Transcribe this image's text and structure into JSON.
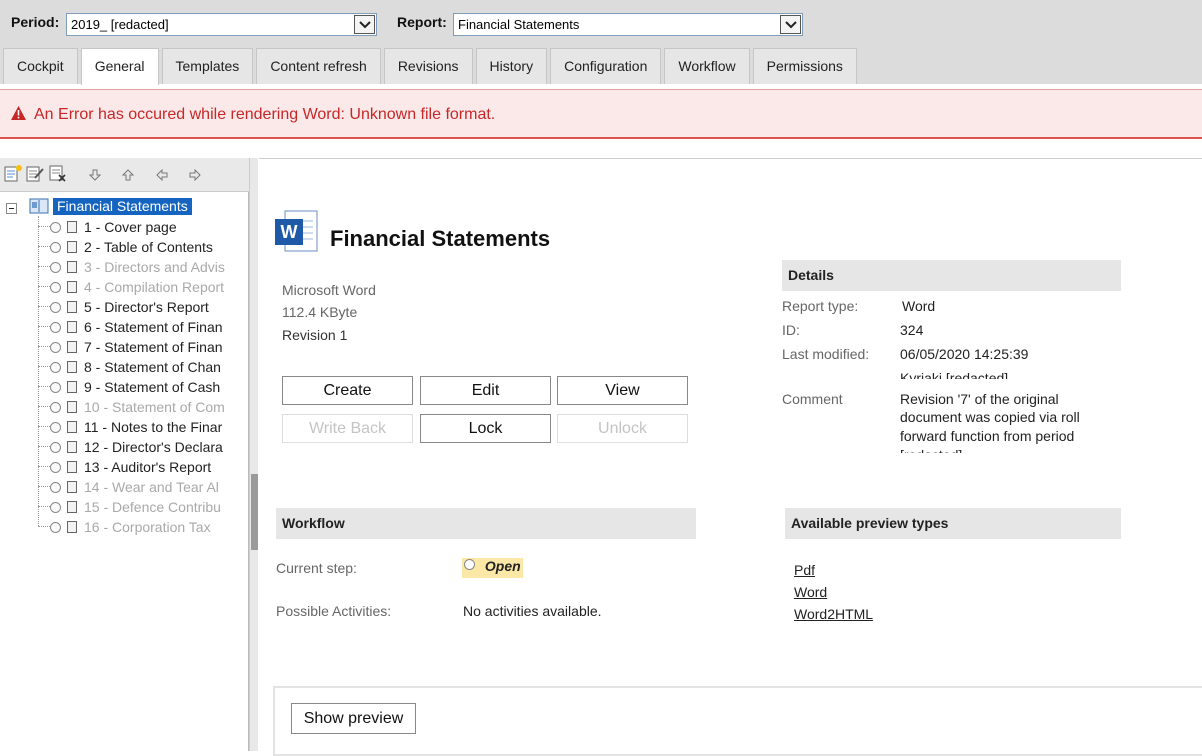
{
  "header": {
    "period_label": "Period:",
    "period_value": "2019_ [redacted]",
    "report_label": "Report:",
    "report_value": "Financial Statements"
  },
  "tabs": [
    "Cockpit",
    "General",
    "Templates",
    "Content refresh",
    "Revisions",
    "History",
    "Configuration",
    "Workflow",
    "Permissions"
  ],
  "active_tab": "General",
  "error": {
    "message": "An Error has occured while rendering Word: Unknown file format."
  },
  "tree": {
    "root": "Financial Statements",
    "items": [
      {
        "label": "1 - Cover page",
        "disabled": false
      },
      {
        "label": "2 - Table of Contents",
        "disabled": false
      },
      {
        "label": "3 - Directors and Advis",
        "disabled": true
      },
      {
        "label": "4 - Compilation Report",
        "disabled": true
      },
      {
        "label": "5 - Director's Report",
        "disabled": false
      },
      {
        "label": "6 - Statement of Finan",
        "disabled": false
      },
      {
        "label": "7 - Statement of Finan",
        "disabled": false
      },
      {
        "label": "8 - Statement of Chan",
        "disabled": false
      },
      {
        "label": "9 - Statement of Cash",
        "disabled": false
      },
      {
        "label": "10 - Statement of Com",
        "disabled": true
      },
      {
        "label": "11 - Notes to the Finar",
        "disabled": false
      },
      {
        "label": "12 - Director's Declara",
        "disabled": false
      },
      {
        "label": "13 - Auditor's Report",
        "disabled": false
      },
      {
        "label": "14 - Wear and Tear Al",
        "disabled": true
      },
      {
        "label": "15 - Defence Contribu",
        "disabled": true
      },
      {
        "label": "16 - Corporation Tax",
        "disabled": true
      }
    ]
  },
  "document": {
    "title": "Financial Statements",
    "app": "Microsoft Word",
    "size": "112.4 KByte",
    "revision": "Revision 1"
  },
  "buttons": {
    "create": "Create",
    "edit": "Edit",
    "view": "View",
    "write_back": "Write Back",
    "lock": "Lock",
    "unlock": "Unlock",
    "show_preview": "Show preview"
  },
  "details": {
    "header": "Details",
    "report_type_label": "Report type:",
    "report_type_value": "Word",
    "id_label": "ID:",
    "id_value": "324",
    "last_modified_label": "Last modified:",
    "last_modified_value": "06/05/2020 14:25:39",
    "last_modified_user": "Kyriaki [redacted]",
    "comment_label": "Comment",
    "comment_line1": "Revision '7' of the original",
    "comment_line2": "document was copied via roll",
    "comment_line3": "forward function from period",
    "comment_line4": "[redacted]"
  },
  "workflow": {
    "header": "Workflow",
    "current_step_label": "Current step:",
    "current_step_value": "Open",
    "possible_activities_label": "Possible Activities:",
    "possible_activities_value": "No activities available."
  },
  "preview": {
    "header": "Available preview types",
    "types": [
      "Pdf",
      "Word",
      "Word2HTML"
    ]
  },
  "colors": {
    "tree_selection": "#1565c0",
    "error_text": "#c62828",
    "error_bg": "#fbe9e9",
    "step_highlight": "#fbe8a6"
  }
}
